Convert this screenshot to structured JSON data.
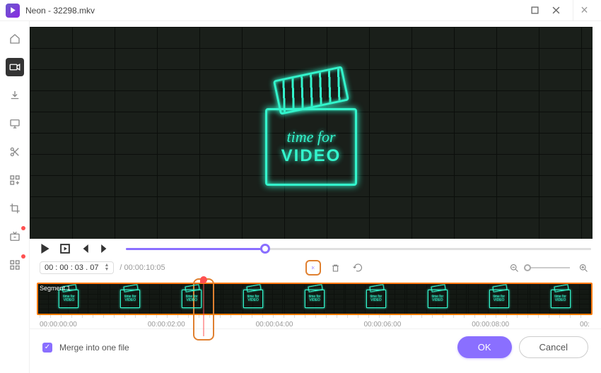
{
  "titlebar": {
    "title": "Neon - 32298.mkv"
  },
  "sidebar": {
    "items": [
      {
        "icon": "home"
      },
      {
        "icon": "video"
      },
      {
        "icon": "download"
      },
      {
        "icon": "monitor"
      },
      {
        "icon": "scissors"
      },
      {
        "icon": "grid-plus"
      },
      {
        "icon": "crop"
      },
      {
        "icon": "tv-play"
      },
      {
        "icon": "apps"
      }
    ]
  },
  "preview": {
    "neon_line1": "time for",
    "neon_line2": "VIDEO"
  },
  "time": {
    "current": "00 : 00 : 03 . 07",
    "duration": "/ 00:00:10:05"
  },
  "timeline": {
    "segment_label": "Segment 1",
    "ticks": [
      "00:00:00:00",
      "00:00:02:00",
      "00:00:04:00",
      "00:00:06:00",
      "00:00:08:00",
      "00:"
    ]
  },
  "footer": {
    "merge_label": "Merge into one file",
    "ok_label": "OK",
    "cancel_label": "Cancel"
  }
}
